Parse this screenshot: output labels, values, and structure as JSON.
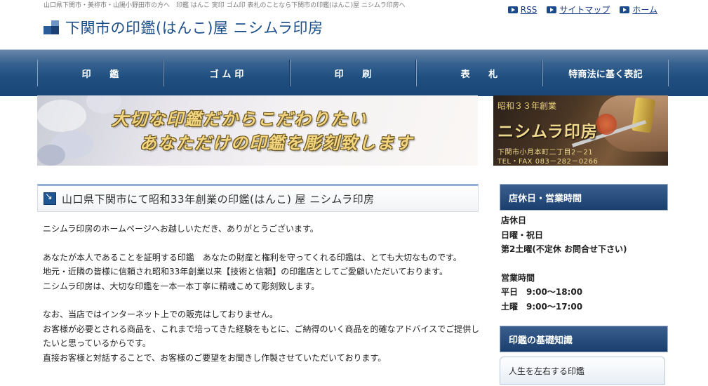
{
  "header": {
    "tagline": "山口県下関市・美祢市・山陽小野田市の方へ　印鑑 はんこ 実印 ゴム印 表札のことなら下関市の印鑑(はんこ)屋 ニシムラ印房へ",
    "site_title": "下関市の印鑑(はんこ)屋 ニシムラ印房",
    "links": [
      "RSS",
      "サイトマップ",
      "ホーム"
    ]
  },
  "nav": {
    "items": [
      "印　　鑑",
      "ゴ ム 印",
      "印　　刷",
      "表　　札",
      "特商法に基く表記"
    ]
  },
  "banner": {
    "line1": "大切な印鑑だからこだわりたい",
    "line2": "あなただけの印鑑を彫刻致します",
    "since": "昭和３３年創業",
    "shop_name": "ニシムラ印房",
    "address": "下関市小月本町二丁目2－21",
    "tel": "TEL・FAX 083－282－0266"
  },
  "main": {
    "section_title": "山口県下関市にて昭和33年創業の印鑑(はんこ) 屋 ニシムラ印房",
    "paragraphs": [
      "ニシムラ印房のホームページへお越しいただき、ありがとうございます。",
      "",
      "あなたが本人であることを証明する印鑑　あなたの財産と権利を守ってくれる印鑑は、とても大切なものです。",
      "地元・近隣の皆様に信頼され昭和33年創業以来【技術と信頼】の印鑑店としてご愛顧いただいております。",
      "ニシムラ印房は、大切な印鑑を一本一本丁寧に精魂こめて彫刻致します。",
      "",
      "なお、当店ではインターネット上での販売はしておりません。",
      "お客様が必要とされる商品を、これまで培ってきた経験をもとに、ご納得のいく商品を的確なアドバイスでご提供し",
      "たいと思っているからです。",
      "直接お客様と対話することで、お客様のご要望をお聞きし作製させていただいております。"
    ]
  },
  "sidebar": {
    "hours_title": "店休日・営業時間",
    "hours_lines": [
      "店休日",
      "日曜・祝日",
      "第2土曜(不定休 お問合せ下さい)",
      "",
      "営業時間",
      "平日　9:00～18:00",
      "土曜　9:00～17:00"
    ],
    "knowledge_title": "印鑑の基礎知識",
    "knowledge_items": [
      "人生を左右する印鑑"
    ]
  },
  "colors": {
    "nav_bg": "#1f4e80",
    "title_blue": "#1c4f8a",
    "banner_text_gold": "#f2d57e"
  }
}
